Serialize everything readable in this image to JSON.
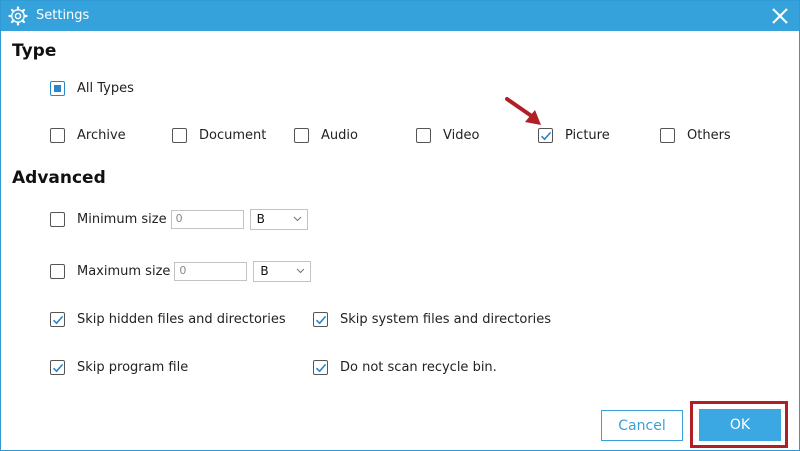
{
  "window": {
    "title": "Settings"
  },
  "type_section": {
    "heading": "Type",
    "all_types": {
      "label": "All Types",
      "state": "partial"
    },
    "options": [
      {
        "label": "Archive",
        "checked": false
      },
      {
        "label": "Document",
        "checked": false
      },
      {
        "label": "Audio",
        "checked": false
      },
      {
        "label": "Video",
        "checked": false
      },
      {
        "label": "Picture",
        "checked": true
      },
      {
        "label": "Others",
        "checked": false
      }
    ]
  },
  "advanced_section": {
    "heading": "Advanced",
    "min_size": {
      "label": "Minimum size",
      "checked": false,
      "value": "0",
      "unit": "B"
    },
    "max_size": {
      "label": "Maximum size",
      "checked": false,
      "value": "0",
      "unit": "B"
    },
    "skip_hidden": {
      "label": "Skip hidden files and directories",
      "checked": true
    },
    "skip_system": {
      "label": "Skip system files and directories",
      "checked": true
    },
    "skip_program": {
      "label": "Skip program file",
      "checked": true
    },
    "no_recycle": {
      "label": "Do not scan recycle bin.",
      "checked": true
    }
  },
  "buttons": {
    "cancel": "Cancel",
    "ok": "OK"
  },
  "colors": {
    "titlebar": "#35a2dc",
    "accent": "#2b86c7",
    "annotation": "#b01f25"
  },
  "icons": {
    "title": "gear-icon",
    "close": "close-icon",
    "annotation_arrow": "red-arrow-icon"
  }
}
